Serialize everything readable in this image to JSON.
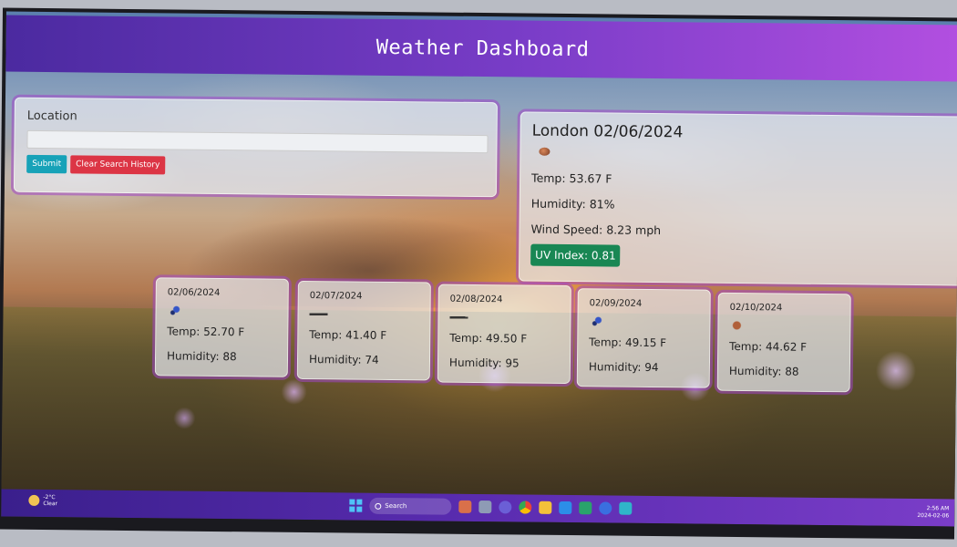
{
  "app": {
    "title": "Weather Dashboard"
  },
  "search": {
    "label": "Location",
    "input_value": "",
    "submit_label": "Submit",
    "clear_label": "Clear Search History"
  },
  "current": {
    "city_date": "London 02/06/2024",
    "icon": "weather-icon",
    "temp": "Temp: 53.67 F",
    "humidity": "Humidity: 81%",
    "wind": "Wind Speed: 8.23 mph",
    "uv": "UV Index: 0.81",
    "uv_color": "#198754"
  },
  "forecast": [
    {
      "date": "02/06/2024",
      "icon": "rain-icon",
      "temp": "Temp: 52.70 F",
      "humidity": "Humidity: 88"
    },
    {
      "date": "02/07/2024",
      "icon": "cloud-icon",
      "temp": "Temp: 41.40 F",
      "humidity": "Humidity: 74"
    },
    {
      "date": "02/08/2024",
      "icon": "cloud-icon",
      "temp": "Temp: 49.50 F",
      "humidity": "Humidity: 95"
    },
    {
      "date": "02/09/2024",
      "icon": "rain-icon",
      "temp": "Temp: 49.15 F",
      "humidity": "Humidity: 94"
    },
    {
      "date": "02/10/2024",
      "icon": "weather-icon",
      "temp": "Temp: 44.62 F",
      "humidity": "Humidity: 88"
    }
  ],
  "taskbar": {
    "weather_temp": "-2°C",
    "weather_cond": "Clear",
    "search_label": "Search",
    "time": "2:56 AM",
    "date": "2024-02-06"
  },
  "colors": {
    "header_start": "#4b2aa0",
    "header_end": "#b24fe0",
    "submit": "#17a2b8",
    "clear": "#dc3545"
  }
}
